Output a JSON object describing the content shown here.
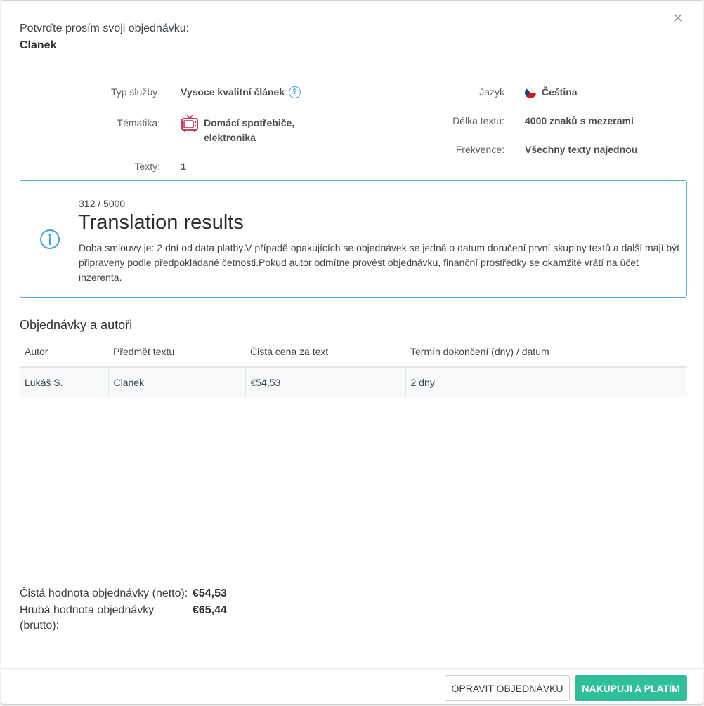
{
  "header": {
    "subtitle": "Potvrďte prosím svoji objednávku:",
    "title": "Clanek",
    "close_label": "×"
  },
  "details": {
    "left": [
      {
        "label": "Typ služby:",
        "value": "Vysoce kvalitní článek",
        "icon": "help-icon"
      },
      {
        "label": "Tématika:",
        "value": "Domácí spotřebiče, elektronika",
        "icon": "tv-icon"
      },
      {
        "label": "Texty:",
        "value": "1"
      }
    ],
    "right": [
      {
        "label": "Jazyk",
        "value": "Čeština",
        "icon": "czech-flag-icon"
      },
      {
        "label": "Délka textu:",
        "value": "4000 znaků s mezerami"
      },
      {
        "label": "Frekvence:",
        "value": "Všechny texty najednou"
      }
    ],
    "help_glyph": "?"
  },
  "info_box": {
    "counter": "312 / 5000",
    "title": "Translation results",
    "text": "Doba smlouvy je: 2 dní od data platby.V případě opakujících se objednávek se jedná o datum doručení první skupiny textů a další mají být připraveny podle předpokládané četnosti.Pokud autor odmítne provést objednávku, finanční prostředky se okamžitě vrátí na účet inzerenta.",
    "icon": "info-icon",
    "accent": "#3aa3e3"
  },
  "orders": {
    "title": "Objednávky a autoři",
    "columns": [
      "Autor",
      "Předmět textu",
      "Čistá cena za text",
      "Termín dokončení (dny) / datum"
    ],
    "rows": [
      [
        "Lukáš S.",
        "Clanek",
        "€54,53",
        "2 dny"
      ]
    ]
  },
  "totals": {
    "net_label": "Čistá hodnota objednávky (netto):",
    "net_value": "€54,53",
    "gross_label": "Hrubá hodnota objednávky (brutto):",
    "gross_value": "€65,44"
  },
  "footer": {
    "edit_label": "OPRAVIT OBJEDNÁVKU",
    "buy_label": "NAKUPUJI A PLATÍM",
    "buy_color": "#2fbf9b"
  }
}
